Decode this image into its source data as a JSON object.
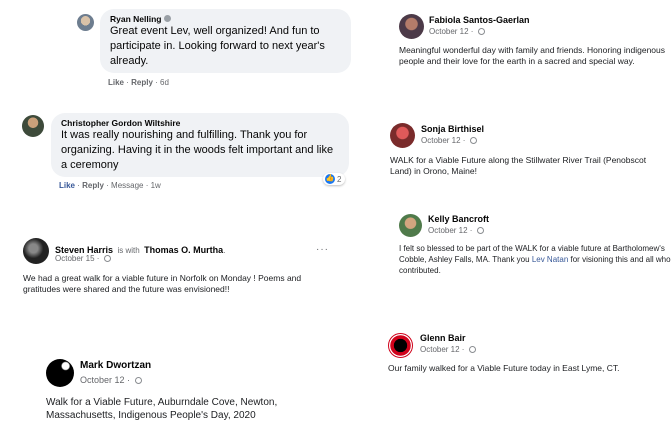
{
  "comments": {
    "ryan": {
      "name": "Ryan Nelling",
      "text": "Great event Lev, well organized! And fun to participate in. Looking forward to next year's already.",
      "like": "Like",
      "reply": "Reply",
      "time": "6d"
    },
    "christopher": {
      "name": "Christopher Gordon Wiltshire",
      "text": "It was really nourishing and fulfilling. Thank you for organizing. Having it in the woods felt important and like a ceremony",
      "like": "Like",
      "reply": "Reply",
      "message": "Message",
      "time": "1w",
      "reaction_count": "2"
    }
  },
  "posts": {
    "steven": {
      "name": "Steven Harris",
      "with_text": "is with",
      "tagged": "Thomas O. Murtha",
      "date": "October 15",
      "text": "We had a great walk for a viable future in Norfolk on Monday ! Poems and gratitudes were shared and the future was envisioned!!"
    },
    "mark": {
      "name": "Mark Dwortzan",
      "date": "October 12",
      "text": "Walk for a Viable Future, Auburndale Cove, Newton, Massachusetts, Indigenous People's Day, 2020"
    },
    "fabiola": {
      "name": "Fabiola Santos-Gaerlan",
      "date": "October 12",
      "text": "Meaningful wonderful day with family and friends. Honoring indigenous people and their love for the earth in a sacred and special way."
    },
    "sonja": {
      "name": "Sonja Birthisel",
      "date": "October 12",
      "text": "WALK for a Viable Future along the Stillwater River Trail (Penobscot Land) in Orono, Maine!"
    },
    "kelly": {
      "name": "Kelly Bancroft",
      "date": "October 12",
      "text_before": "I felt so blessed to be part of the WALK for a viable future at Bartholomew's Cobble, Ashley Falls, MA. Thank you ",
      "link": "Lev Natan",
      "text_after": " for visioning this and all who contributed."
    },
    "glenn": {
      "name": "Glenn Bair",
      "date": "October 12",
      "text": "Our family walked for a Viable Future today in East Lyme, CT."
    }
  },
  "colors": {
    "link": "#385898",
    "meta": "#65676b",
    "bubble": "#f0f2f5",
    "like_blue": "#1877f2"
  },
  "icons": [
    "globe-icon",
    "more-options-icon",
    "like-reaction-icon",
    "verified-icon"
  ]
}
